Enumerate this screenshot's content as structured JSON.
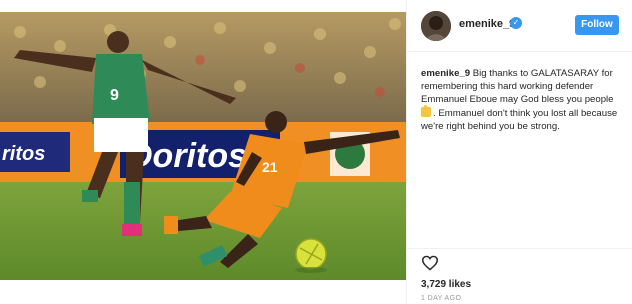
{
  "post": {
    "photo_icon": "soccer-match-photo",
    "photo_text": {
      "banner": "Doritos",
      "green_player_number": "9",
      "orange_player_number": "21"
    }
  },
  "header": {
    "username": "emenike_9",
    "verified_icon": "verified-badge-icon",
    "verified_symbol": "✓",
    "follow_label": "Follow"
  },
  "caption": {
    "username": "emenike_9",
    "text_before_emoji": "Big thanks to GALATASARAY for remembering this hard working defender Emmanuel Eboue may God bless you people",
    "emoji_icon": "thumbs-up-icon",
    "text_after_emoji": ". Emmanuel don't think you lost all because we're right behind you be strong."
  },
  "actions": {
    "like_icon": "heart-icon",
    "likes": "3,729 likes",
    "time_ago": "1 DAY AGO"
  },
  "colors": {
    "accent": "#3897f0",
    "text": "#262626",
    "muted": "#999999"
  }
}
